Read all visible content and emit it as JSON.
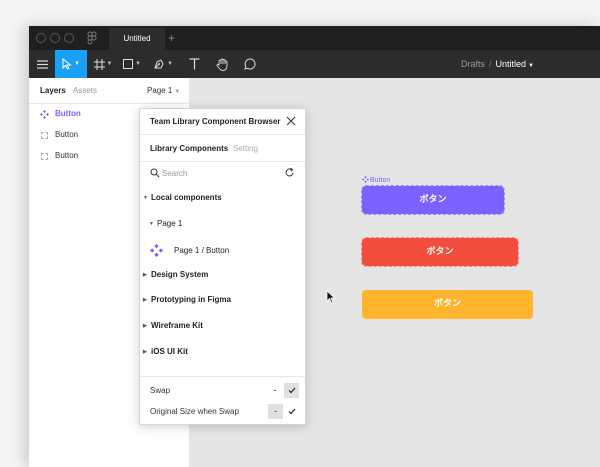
{
  "titlebar": {
    "tab_title": "Untitled",
    "add_tab": "+"
  },
  "toolbar": {
    "breadcrumb_parent": "Drafts",
    "breadcrumb_separator": "/",
    "breadcrumb_file": "Untitled",
    "accent_color": "#18a0fb"
  },
  "layers_panel": {
    "tabs": [
      "Layers",
      "Assets"
    ],
    "page_selector": "Page 1",
    "layers": [
      {
        "name": "Button",
        "selected": true
      },
      {
        "name": "Button",
        "selected": false
      },
      {
        "name": "Button",
        "selected": false
      }
    ]
  },
  "modal": {
    "title": "Team Library Component Browser",
    "tabs": [
      "Library Components",
      "Setting"
    ],
    "search_placeholder": "Search",
    "tree": {
      "local_components": "Local components",
      "page": "Page 1",
      "component": "Page 1 / Button",
      "libraries": [
        "Design System",
        "Prototyping in Figma",
        "Wireframe Kit",
        "iOS UI Kit"
      ]
    },
    "options": [
      {
        "label": "Swap",
        "dash": "-",
        "checked": true
      },
      {
        "label": "Original Size when Swap",
        "dash": "-",
        "checked": true
      }
    ]
  },
  "canvas": {
    "component_label": "Button",
    "buttons": [
      {
        "label": "ボタン",
        "color": "#7b61ff"
      },
      {
        "label": "ボタン",
        "color": "#f24e3e"
      },
      {
        "label": "ボタン",
        "color": "#ffb52e"
      }
    ]
  }
}
